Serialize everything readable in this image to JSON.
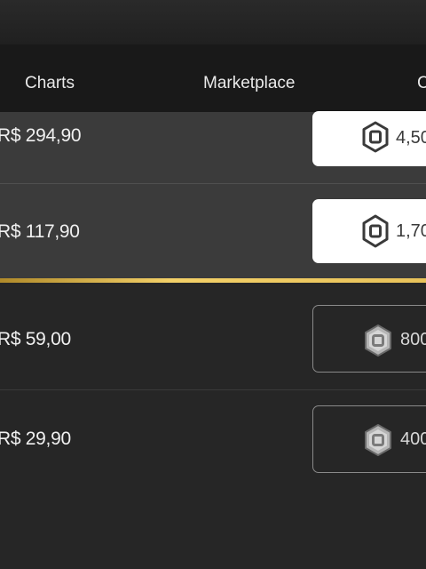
{
  "nav": {
    "tabs": [
      {
        "label": "Charts"
      },
      {
        "label": "Marketplace"
      },
      {
        "label": "C"
      }
    ]
  },
  "packages": [
    {
      "price": "R$ 294,90",
      "amount": "4,50",
      "style": "light"
    },
    {
      "price": "R$ 117,90",
      "amount": "1,70",
      "style": "light"
    },
    {
      "price": "R$ 59,00",
      "amount": "800",
      "style": "dark"
    },
    {
      "price": "R$ 29,90",
      "amount": "400",
      "style": "dark"
    }
  ],
  "icons": {
    "currency": "robux-hexagon-icon"
  },
  "colors": {
    "highlight": "#e8c25a",
    "button_light": "#ffffff",
    "background": "#242424"
  }
}
